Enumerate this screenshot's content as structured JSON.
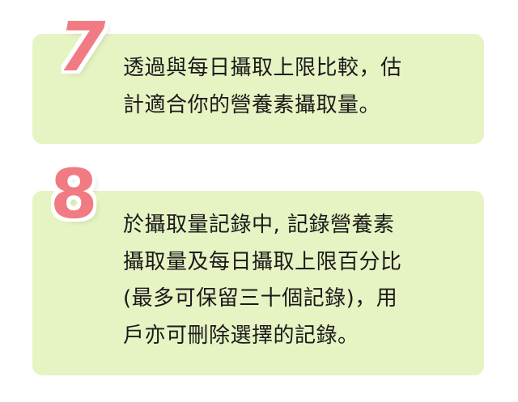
{
  "steps": [
    {
      "number": "7",
      "description": "透過與每日攝取上限比較，估\n計適合你的營養素攝取量。"
    },
    {
      "number": "8",
      "description": "於攝取量記錄中, 記錄營養素\n攝取量及每日攝取上限百分比\n(最多可保留三十個記錄)，用\n戶亦可刪除選擇的記錄。"
    }
  ],
  "colors": {
    "card_background": "#e6f3c3",
    "number_color": "#f07b82"
  }
}
